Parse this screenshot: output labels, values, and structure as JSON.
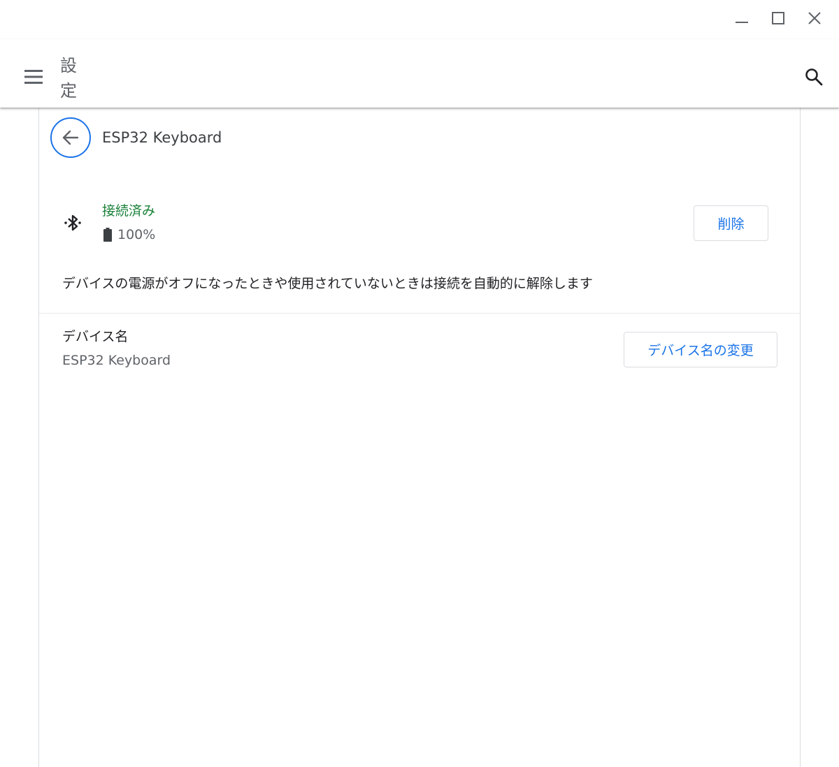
{
  "window": {
    "controls": [
      "minimize-icon",
      "maximize-icon",
      "close-icon"
    ]
  },
  "header": {
    "title": "設定",
    "menu_icon": "hamburger-menu-icon",
    "search_icon": "search-icon"
  },
  "page": {
    "title": "ESP32 Keyboard",
    "back_icon": "arrow-back-icon"
  },
  "device": {
    "icon": "bluetooth-connected-icon",
    "status": "接続済み",
    "battery_icon": "battery-full-icon",
    "battery": "100%",
    "remove_label": "削除",
    "description": "デバイスの電源がオフになったときや使用されていないときは接続を自動的に解除します"
  },
  "device_name": {
    "label": "デバイス名",
    "value": "ESP32 Keyboard",
    "rename_label": "デバイス名の変更"
  },
  "colors": {
    "accent": "#1a73e8",
    "connected": "#188038",
    "secondary_text": "#5f6368",
    "border": "#dadce0"
  }
}
